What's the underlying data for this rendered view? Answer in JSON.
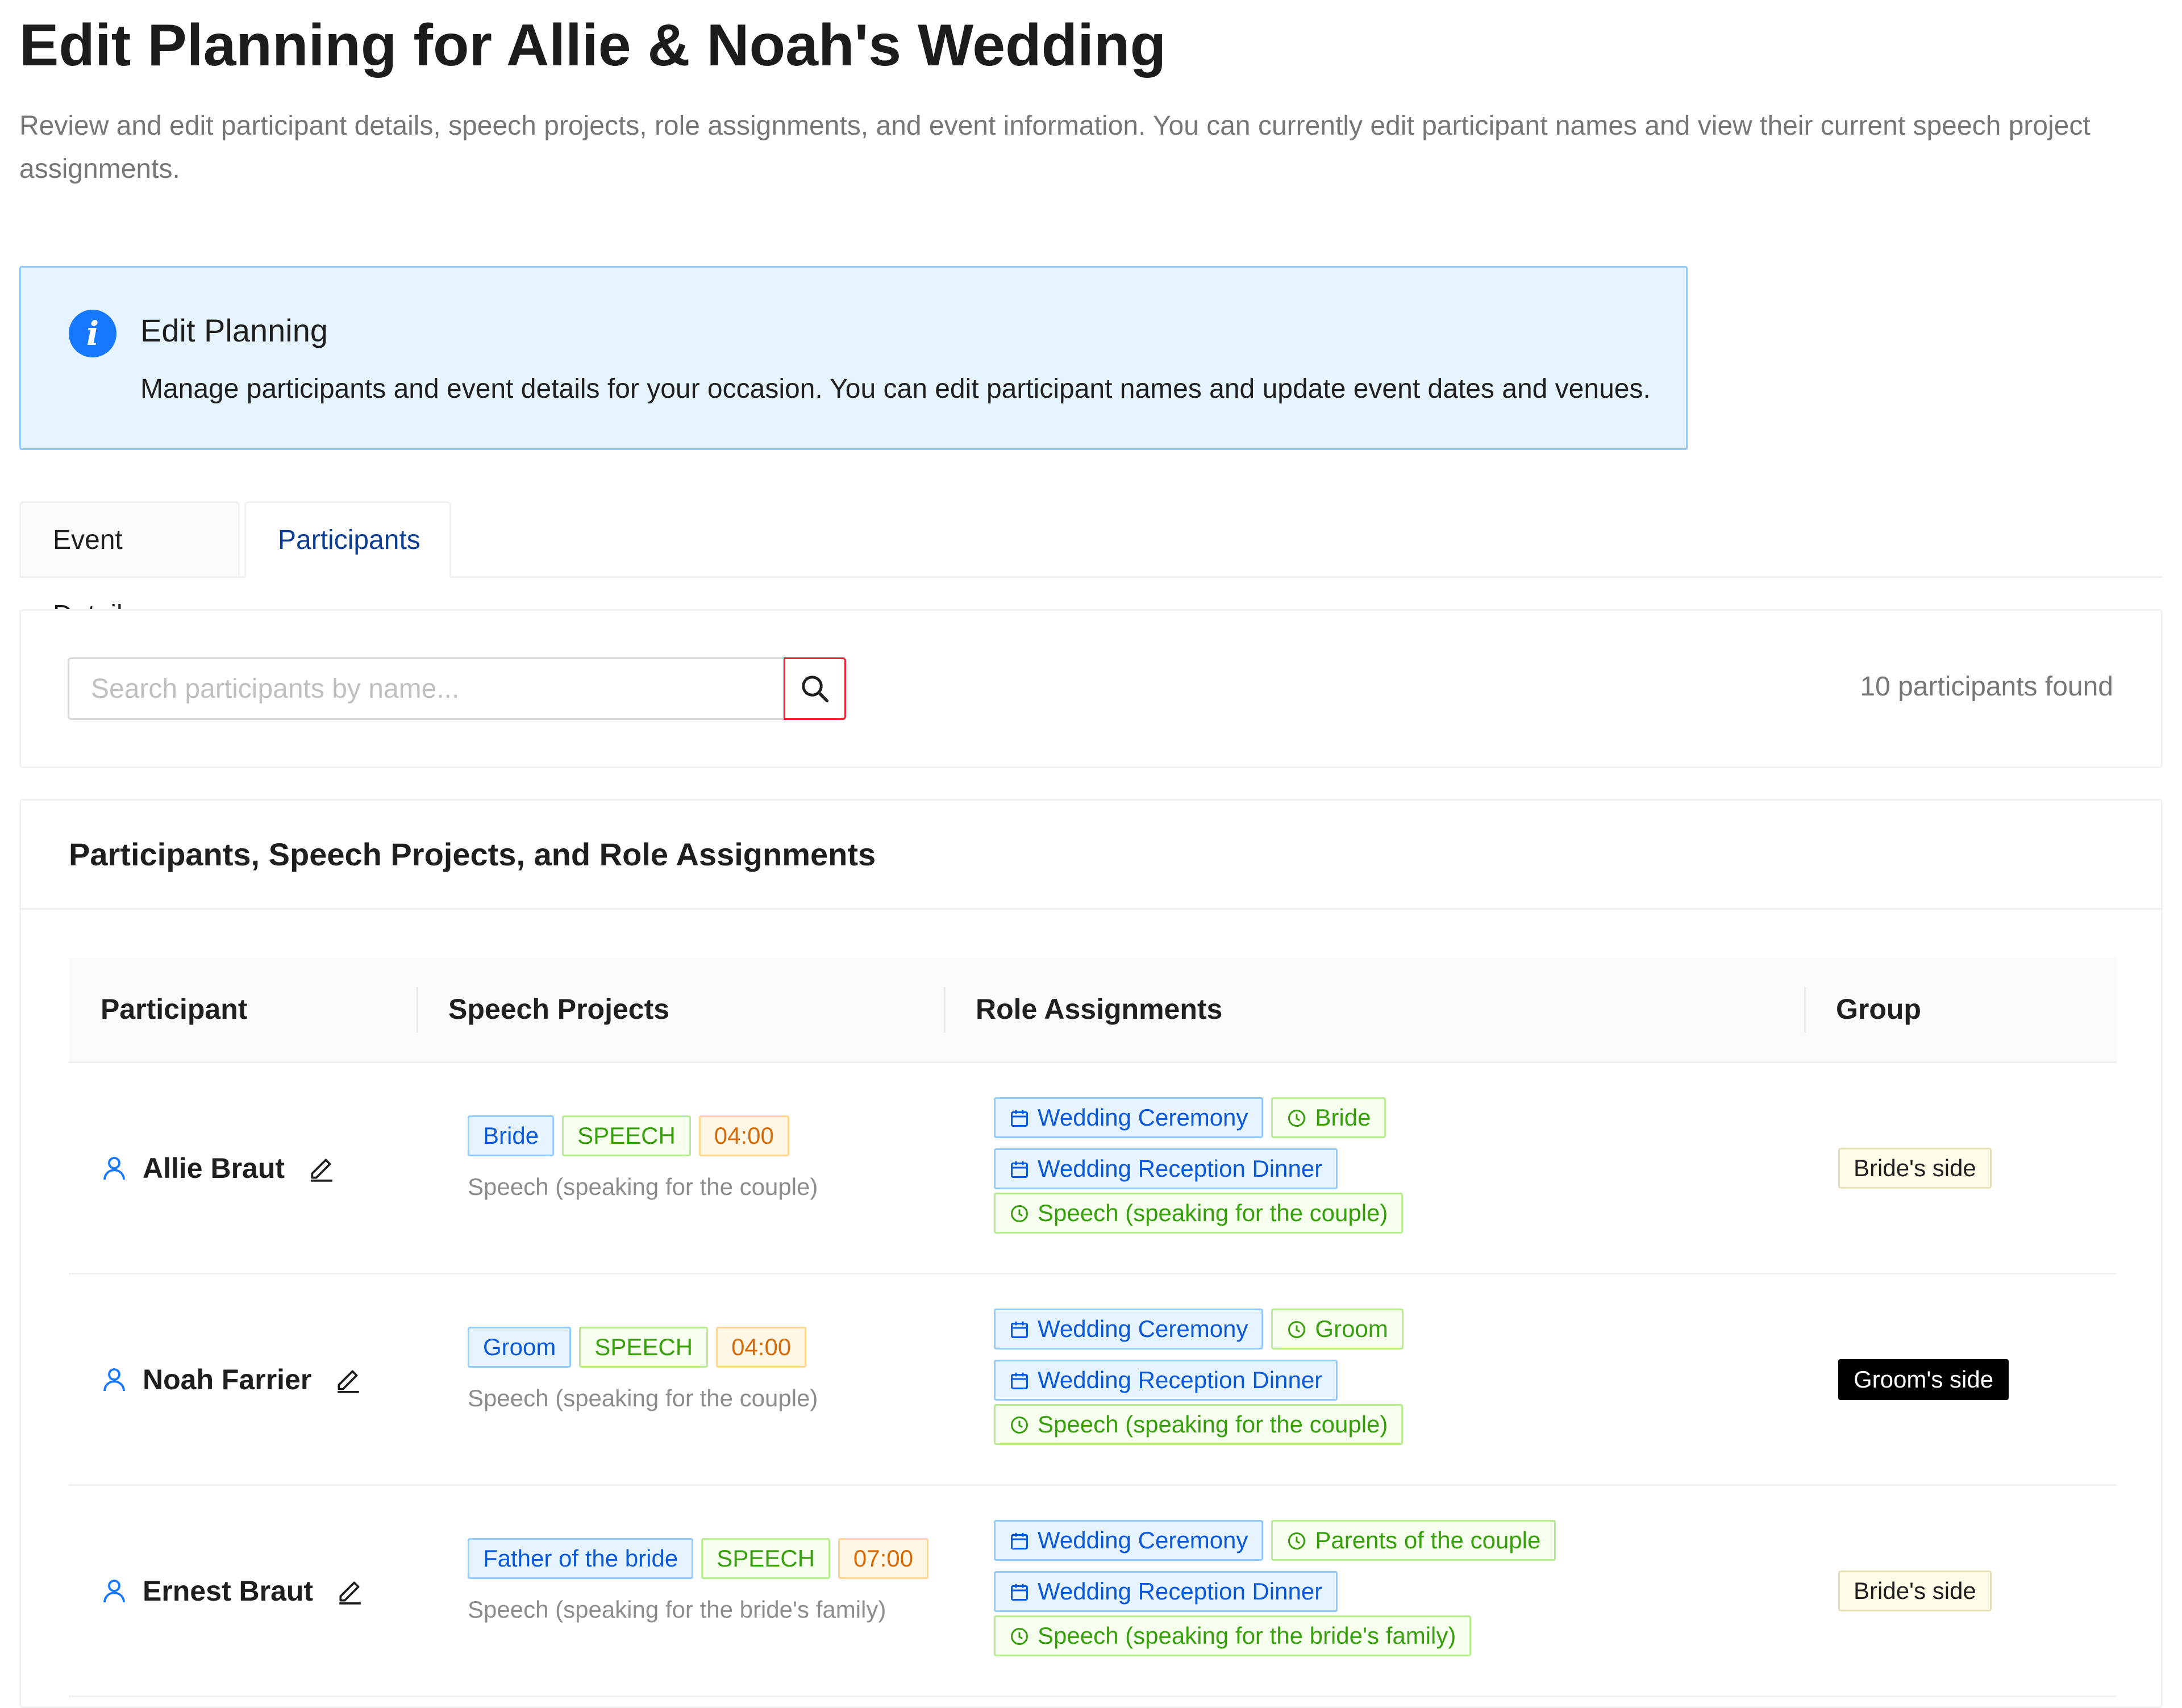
{
  "header": {
    "title": "Edit Planning for Allie & Noah's Wedding",
    "subtitle": "Review and edit participant details, speech projects, role assignments, and event information. You can currently edit participant names and view their current speech project assignments."
  },
  "alert": {
    "icon": "info-icon",
    "title": "Edit Planning",
    "description": "Manage participants and event details for your occasion. You can edit participant names and update event dates and venues."
  },
  "tabs": [
    {
      "label": "Event Details",
      "active": false
    },
    {
      "label": "Participants",
      "active": true
    }
  ],
  "search": {
    "placeholder": "Search participants by name...",
    "value": "",
    "count_text": "10 participants found"
  },
  "table": {
    "title": "Participants, Speech Projects, and Role Assignments",
    "columns": [
      "Participant",
      "Speech Projects",
      "Role Assignments",
      "Group"
    ],
    "rows": [
      {
        "name": "Allie Braut",
        "speech_tags": [
          "Bride",
          "SPEECH",
          "04:00"
        ],
        "speech_desc": "Speech (speaking for the couple)",
        "roles": {
          "ceremony": "Wedding Ceremony",
          "ceremony_role": "Bride",
          "dinner": "Wedding Reception Dinner",
          "dinner_role": "Speech (speaking for the couple)"
        },
        "group": "Bride's side"
      },
      {
        "name": "Noah Farrier",
        "speech_tags": [
          "Groom",
          "SPEECH",
          "04:00"
        ],
        "speech_desc": "Speech (speaking for the couple)",
        "roles": {
          "ceremony": "Wedding Ceremony",
          "ceremony_role": "Groom",
          "dinner": "Wedding Reception Dinner",
          "dinner_role": "Speech (speaking for the couple)"
        },
        "group": "Groom's side"
      },
      {
        "name": "Ernest Braut",
        "speech_tags": [
          "Father of the bride",
          "SPEECH",
          "07:00"
        ],
        "speech_desc": "Speech (speaking for the bride's family)",
        "roles": {
          "ceremony": "Wedding Ceremony",
          "ceremony_role": "Parents of the couple",
          "dinner": "Wedding Reception Dinner",
          "dinner_role": "Speech (speaking for the bride's family)"
        },
        "group": "Bride's side"
      }
    ]
  },
  "colors": {
    "accent_blue": "#1677ff",
    "tag_blue": "#0958d9",
    "tag_green": "#389e0d",
    "tag_orange": "#d46b08",
    "groom_tag_bg": "#000000"
  }
}
